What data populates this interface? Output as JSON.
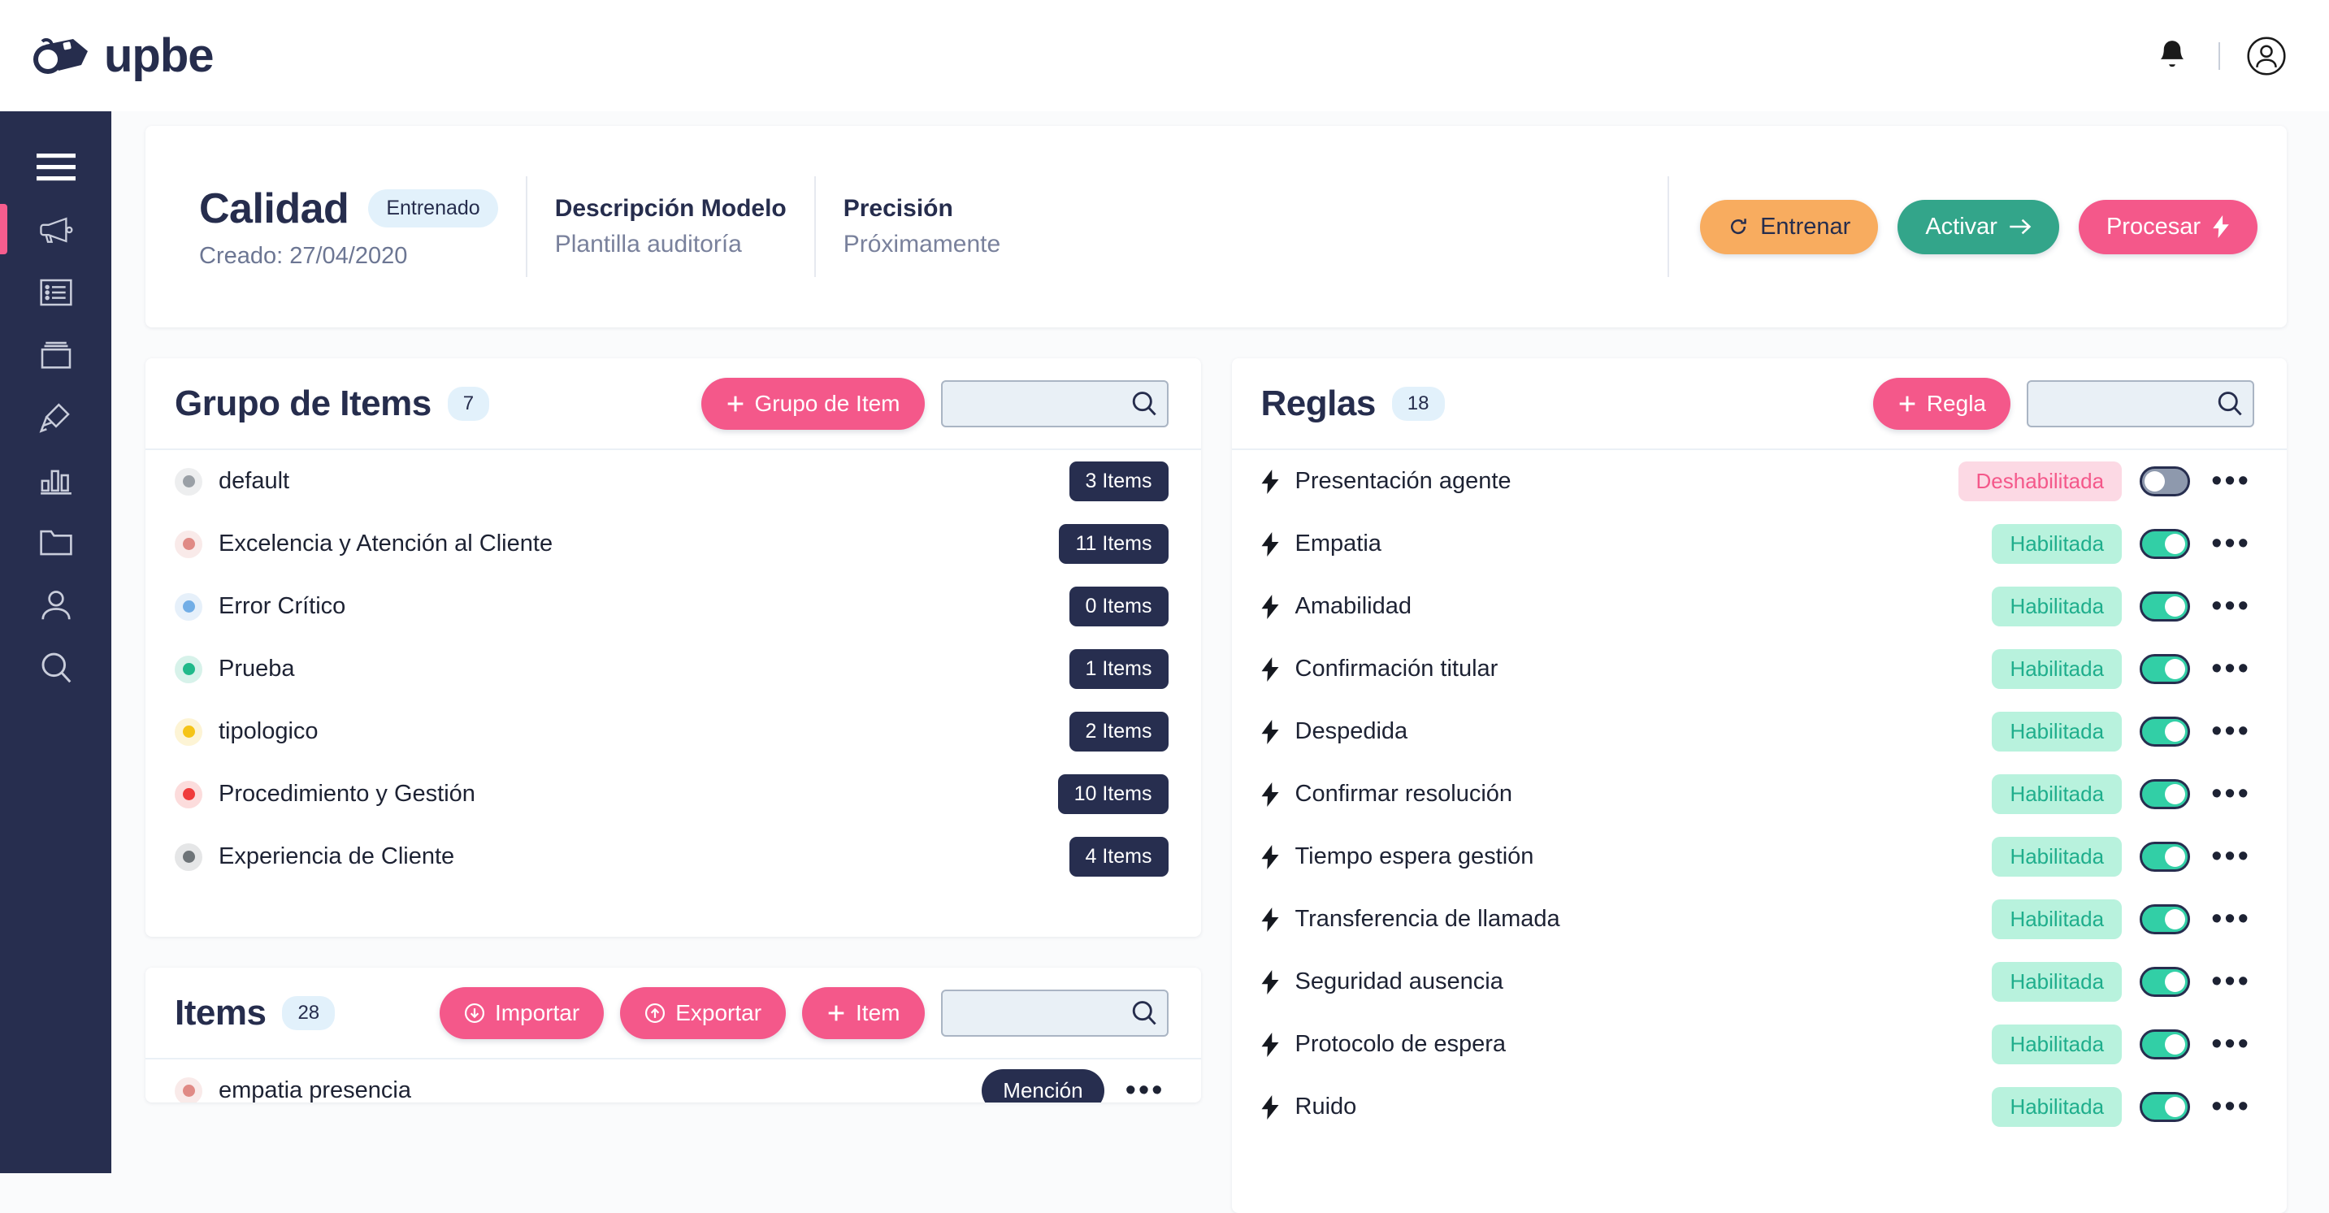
{
  "brand": {
    "name": "upbe",
    "logo_icon": "whistle-icon"
  },
  "topbar": {
    "notifications_icon": "bell-icon",
    "account_icon": "user-circle-icon"
  },
  "sidebar": {
    "items": [
      {
        "icon": "hamburger-menu-icon",
        "name": "menu-toggle",
        "active": false
      },
      {
        "icon": "megaphone-icon",
        "name": "campaigns",
        "active": true
      },
      {
        "icon": "list-icon",
        "name": "lists",
        "active": false
      },
      {
        "icon": "archive-box-icon",
        "name": "archive",
        "active": false
      },
      {
        "icon": "highlighter-icon",
        "name": "annotations",
        "active": false
      },
      {
        "icon": "bar-chart-icon",
        "name": "analytics",
        "active": false
      },
      {
        "icon": "folder-icon",
        "name": "files",
        "active": false
      },
      {
        "icon": "user-icon",
        "name": "users",
        "active": false
      },
      {
        "icon": "search-icon",
        "name": "search",
        "active": false
      }
    ]
  },
  "model_header": {
    "title": "Calidad",
    "status_badge": "Entrenado",
    "created_label": "Creado: 27/04/2020",
    "description_label": "Descripción Modelo",
    "description_value": "Plantilla auditoría",
    "precision_label": "Precisión",
    "precision_value": "Próximamente",
    "actions": [
      {
        "label": "Entrenar",
        "icon": "refresh-icon",
        "style": "orange"
      },
      {
        "label": "Activar",
        "icon": "arrow-right-icon",
        "style": "teal"
      },
      {
        "label": "Procesar",
        "icon": "lightning-icon",
        "style": "pink"
      }
    ]
  },
  "item_groups_panel": {
    "title": "Grupo de Items",
    "count": "7",
    "add_button": "Grupo de Item",
    "search_placeholder": "",
    "search_value": "",
    "search_icon": "search-icon",
    "rows": [
      {
        "label": "default",
        "count": "3 Items",
        "color": "#9aa0a6"
      },
      {
        "label": "Excelencia y Atención al Cliente",
        "count": "11 Items",
        "color": "#e08a85"
      },
      {
        "label": "Error Crítico",
        "count": "0 Items",
        "color": "#72aee6"
      },
      {
        "label": "Prueba",
        "count": "1 Items",
        "color": "#21b98a"
      },
      {
        "label": "tipologico",
        "count": "2 Items",
        "color": "#f5c417"
      },
      {
        "label": "Procedimiento y Gestión",
        "count": "10 Items",
        "color": "#ef3b3b"
      },
      {
        "label": "Experiencia de Cliente",
        "count": "4 Items",
        "color": "#6e7478"
      }
    ]
  },
  "items_panel": {
    "title": "Items",
    "count": "28",
    "buttons": [
      {
        "label": "Importar",
        "icon": "download-circle-icon"
      },
      {
        "label": "Exportar",
        "icon": "upload-circle-icon"
      },
      {
        "label": "Item",
        "icon": "plus-icon"
      }
    ],
    "search_placeholder": "",
    "search_value": "",
    "search_icon": "search-icon",
    "rows": [
      {
        "label": "empatia presencia",
        "tag": "Mención",
        "color": "#e08a85"
      }
    ]
  },
  "rules_panel": {
    "title": "Reglas",
    "count": "18",
    "add_button": "Regla",
    "search_placeholder": "",
    "search_value": "",
    "search_icon": "search-icon",
    "status_enabled": "Habilitada",
    "status_disabled": "Deshabilitada",
    "rows": [
      {
        "label": "Presentación agente",
        "status": "Deshabilitada",
        "enabled": false
      },
      {
        "label": "Empatia",
        "status": "Habilitada",
        "enabled": true
      },
      {
        "label": "Amabilidad",
        "status": "Habilitada",
        "enabled": true
      },
      {
        "label": "Confirmación titular",
        "status": "Habilitada",
        "enabled": true
      },
      {
        "label": "Despedida",
        "status": "Habilitada",
        "enabled": true
      },
      {
        "label": "Confirmar resolución",
        "status": "Habilitada",
        "enabled": true
      },
      {
        "label": "Tiempo espera gestión",
        "status": "Habilitada",
        "enabled": true
      },
      {
        "label": "Transferencia de llamada",
        "status": "Habilitada",
        "enabled": true
      },
      {
        "label": "Seguridad ausencia",
        "status": "Habilitada",
        "enabled": true
      },
      {
        "label": "Protocolo de espera",
        "status": "Habilitada",
        "enabled": true
      },
      {
        "label": "Ruido",
        "status": "Habilitada",
        "enabled": true
      }
    ]
  },
  "colors": {
    "navy": "#272e4f",
    "pink": "#f4588a",
    "teal": "#33a58a",
    "orange": "#f8ac5f",
    "toggle_on": "#32cfa6",
    "chip_on_bg": "#b8f2dd",
    "chip_off_bg": "#fcd9e4",
    "badge_bg": "#e2f1fb"
  }
}
